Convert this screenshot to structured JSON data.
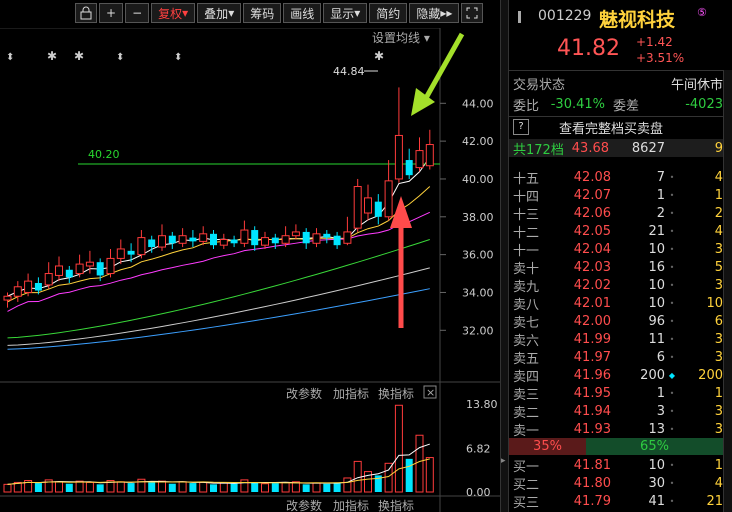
{
  "toolbar": {
    "buttons": [
      "+",
      "−",
      "复权",
      "叠加",
      "筹码",
      "画线",
      "显示",
      "简约",
      "隐藏"
    ],
    "lock_icon": "lock-icon",
    "expand_icon": "expand-icon"
  },
  "main_chart": {
    "settings_link": "设置均线",
    "price_axis": [
      "44.00",
      "42.00",
      "40.00",
      "38.00",
      "36.00",
      "34.00",
      "32.00"
    ],
    "high_label": "44.84",
    "support_label": "40.20",
    "candles": [
      {
        "o": 33.6,
        "c": 33.8,
        "h": 34.0,
        "l": 33.2
      },
      {
        "o": 33.8,
        "c": 34.3,
        "h": 34.6,
        "l": 33.5
      },
      {
        "o": 34.0,
        "c": 34.6,
        "h": 35.0,
        "l": 33.8
      },
      {
        "o": 34.5,
        "c": 34.1,
        "h": 34.8,
        "l": 33.9
      },
      {
        "o": 34.4,
        "c": 35.0,
        "h": 35.6,
        "l": 34.2
      },
      {
        "o": 34.9,
        "c": 35.4,
        "h": 35.9,
        "l": 34.6
      },
      {
        "o": 35.2,
        "c": 34.8,
        "h": 35.4,
        "l": 34.5
      },
      {
        "o": 35.0,
        "c": 35.5,
        "h": 36.0,
        "l": 34.8
      },
      {
        "o": 35.4,
        "c": 35.6,
        "h": 36.2,
        "l": 35.0
      },
      {
        "o": 35.6,
        "c": 34.9,
        "h": 35.8,
        "l": 34.6
      },
      {
        "o": 35.0,
        "c": 35.8,
        "h": 36.3,
        "l": 34.8
      },
      {
        "o": 35.8,
        "c": 36.3,
        "h": 36.8,
        "l": 35.5
      },
      {
        "o": 36.2,
        "c": 36.0,
        "h": 36.6,
        "l": 35.6
      },
      {
        "o": 36.0,
        "c": 36.9,
        "h": 37.3,
        "l": 35.8
      },
      {
        "o": 36.8,
        "c": 36.4,
        "h": 37.0,
        "l": 36.1
      },
      {
        "o": 36.4,
        "c": 37.0,
        "h": 37.6,
        "l": 36.2
      },
      {
        "o": 37.0,
        "c": 36.6,
        "h": 37.2,
        "l": 36.3
      },
      {
        "o": 36.6,
        "c": 37.0,
        "h": 37.4,
        "l": 36.4
      },
      {
        "o": 36.9,
        "c": 36.7,
        "h": 37.3,
        "l": 36.4
      },
      {
        "o": 36.7,
        "c": 37.1,
        "h": 37.5,
        "l": 36.5
      },
      {
        "o": 37.1,
        "c": 36.5,
        "h": 37.3,
        "l": 36.3
      },
      {
        "o": 36.5,
        "c": 36.8,
        "h": 37.1,
        "l": 36.3
      },
      {
        "o": 36.8,
        "c": 36.6,
        "h": 37.0,
        "l": 36.4
      },
      {
        "o": 36.6,
        "c": 37.3,
        "h": 37.8,
        "l": 36.4
      },
      {
        "o": 37.3,
        "c": 36.5,
        "h": 37.5,
        "l": 36.2
      },
      {
        "o": 36.5,
        "c": 36.9,
        "h": 37.2,
        "l": 36.3
      },
      {
        "o": 36.9,
        "c": 36.6,
        "h": 37.1,
        "l": 36.3
      },
      {
        "o": 36.6,
        "c": 37.0,
        "h": 37.5,
        "l": 36.4
      },
      {
        "o": 37.0,
        "c": 37.2,
        "h": 37.6,
        "l": 36.8
      },
      {
        "o": 37.2,
        "c": 36.6,
        "h": 37.4,
        "l": 36.3
      },
      {
        "o": 36.6,
        "c": 37.1,
        "h": 37.4,
        "l": 36.4
      },
      {
        "o": 37.1,
        "c": 36.9,
        "h": 37.3,
        "l": 36.6
      },
      {
        "o": 37.0,
        "c": 36.5,
        "h": 37.2,
        "l": 36.3
      },
      {
        "o": 36.6,
        "c": 37.2,
        "h": 38.0,
        "l": 36.5
      },
      {
        "o": 37.4,
        "c": 39.6,
        "h": 40.0,
        "l": 37.2
      },
      {
        "o": 38.2,
        "c": 39.0,
        "h": 39.7,
        "l": 37.8
      },
      {
        "o": 38.8,
        "c": 38.0,
        "h": 39.2,
        "l": 37.6
      },
      {
        "o": 38.0,
        "c": 39.9,
        "h": 41.0,
        "l": 37.8
      },
      {
        "o": 40.0,
        "c": 42.3,
        "h": 44.84,
        "l": 39.8
      },
      {
        "o": 41.0,
        "c": 40.2,
        "h": 41.6,
        "l": 40.0
      },
      {
        "o": 40.6,
        "c": 41.5,
        "h": 42.2,
        "l": 40.4
      },
      {
        "o": 40.7,
        "c": 41.82,
        "h": 42.6,
        "l": 40.5
      }
    ]
  },
  "volume_panel": {
    "buttons": [
      "改参数",
      "加指标",
      "换指标"
    ],
    "close_label": "×",
    "axis": [
      "13.80",
      "6.82",
      "0.00"
    ],
    "values": [
      1.2,
      1.5,
      1.8,
      1.4,
      1.9,
      1.6,
      1.3,
      1.7,
      1.5,
      1.2,
      1.8,
      1.6,
      1.4,
      2.0,
      1.5,
      1.7,
      1.3,
      1.6,
      1.4,
      1.5,
      1.2,
      1.4,
      1.3,
      1.9,
      1.5,
      1.3,
      1.4,
      1.5,
      1.6,
      1.2,
      1.4,
      1.3,
      1.5,
      2.2,
      4.8,
      3.2,
      2.6,
      4.5,
      13.6,
      5.2,
      8.9,
      5.4
    ]
  },
  "bottom_panel": {
    "buttons": [
      "改参数",
      "加指标",
      "换指标"
    ]
  },
  "quote": {
    "code": "001229",
    "name": "魅视科技",
    "badge": "⑤",
    "price": "41.82",
    "change": "+1.42",
    "change_pct": "+3.51%",
    "status_label": "交易状态",
    "status_value": "午间休市",
    "weibi_label": "委比",
    "weibi_value": "-30.41%",
    "weicha_label": "委差",
    "weicha_value": "-4023",
    "help_icon": "?",
    "full_book_link": "查看完整档买卖盘",
    "total_label": "共172档",
    "total_price": "43.68",
    "total_vol": "8627",
    "total_count": "9",
    "asks": [
      {
        "label": "十五",
        "price": "42.08",
        "vol": "7",
        "cnt": "4"
      },
      {
        "label": "十四",
        "price": "42.07",
        "vol": "1",
        "cnt": "1"
      },
      {
        "label": "十三",
        "price": "42.06",
        "vol": "2",
        "cnt": "2"
      },
      {
        "label": "十二",
        "price": "42.05",
        "vol": "21",
        "cnt": "4"
      },
      {
        "label": "十一",
        "price": "42.04",
        "vol": "10",
        "cnt": "3"
      },
      {
        "label": "卖十",
        "price": "42.03",
        "vol": "16",
        "cnt": "5"
      },
      {
        "label": "卖九",
        "price": "42.02",
        "vol": "10",
        "cnt": "3"
      },
      {
        "label": "卖八",
        "price": "42.01",
        "vol": "10",
        "cnt": "10"
      },
      {
        "label": "卖七",
        "price": "42.00",
        "vol": "96",
        "cnt": "6"
      },
      {
        "label": "卖六",
        "price": "41.99",
        "vol": "11",
        "cnt": "3"
      },
      {
        "label": "卖五",
        "price": "41.97",
        "vol": "6",
        "cnt": "3"
      },
      {
        "label": "卖四",
        "price": "41.96",
        "vol": "200",
        "cnt": "200"
      },
      {
        "label": "卖三",
        "price": "41.95",
        "vol": "1",
        "cnt": "1"
      },
      {
        "label": "卖二",
        "price": "41.94",
        "vol": "3",
        "cnt": "3"
      },
      {
        "label": "卖一",
        "price": "41.93",
        "vol": "13",
        "cnt": "3"
      }
    ],
    "sell_ratio": "35%",
    "buy_ratio": "65%",
    "bids": [
      {
        "label": "买一",
        "price": "41.81",
        "vol": "10",
        "cnt": "1"
      },
      {
        "label": "买二",
        "price": "41.80",
        "vol": "30",
        "cnt": "4"
      },
      {
        "label": "买三",
        "price": "41.79",
        "vol": "41",
        "cnt": "21"
      }
    ]
  },
  "colors": {
    "up": "#ff3b3b",
    "down": "#00e5ff",
    "ma5": "#ffffff",
    "ma10": "#ffd23c",
    "ma20": "#ff3cff",
    "ma30": "#39d839",
    "ma60": "#cccccc",
    "ma120": "#3ca0ff",
    "support": "#29d62f",
    "arrow_red": "#ff4b4b",
    "arrow_green": "#a4e02a"
  }
}
